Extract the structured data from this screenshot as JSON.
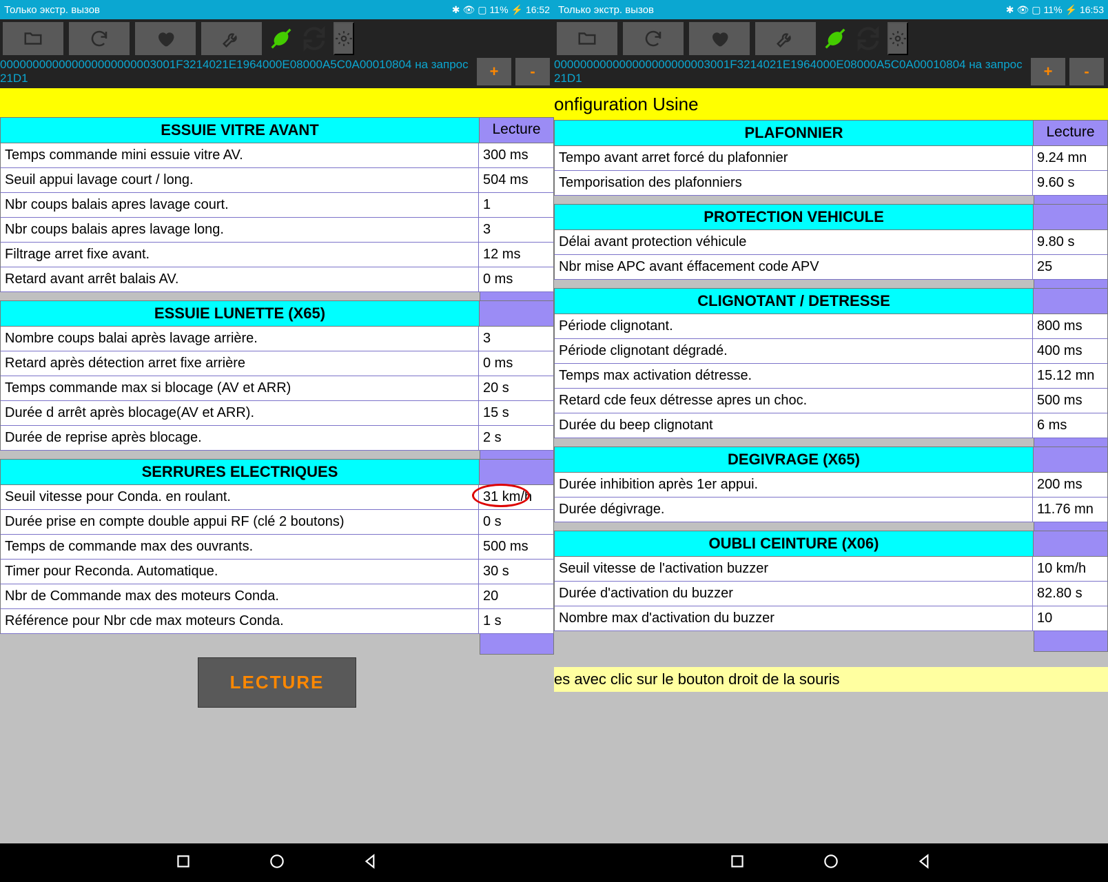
{
  "left": {
    "status": {
      "carrier": "Только экстр. вызов",
      "battery": "11%",
      "time": "16:52"
    },
    "info_line": "000000000000000000000003001F3214021E1964000E08000A5C0A00010804 на запрос 21D1",
    "plus": "+",
    "minus": "-",
    "lecture_btn": "LECTURE",
    "lecture_label": "Lecture",
    "sections": [
      {
        "title": "ESSUIE VITRE AVANT",
        "rows": [
          {
            "label": "Temps commande mini essuie vitre AV.",
            "value": "300 ms"
          },
          {
            "label": "Seuil appui lavage court / long.",
            "value": "504 ms"
          },
          {
            "label": "Nbr coups balais apres lavage court.",
            "value": "1"
          },
          {
            "label": "Nbr coups balais apres lavage long.",
            "value": "3"
          },
          {
            "label": "Filtrage arret fixe avant.",
            "value": "12 ms"
          },
          {
            "label": "Retard avant arrêt balais AV.",
            "value": "0 ms"
          }
        ]
      },
      {
        "title": "ESSUIE LUNETTE (X65)",
        "rows": [
          {
            "label": "Nombre coups balai après lavage arrière.",
            "value": "3"
          },
          {
            "label": "Retard après détection arret fixe arrière",
            "value": "0 ms"
          },
          {
            "label": "Temps commande max si blocage (AV et ARR)",
            "value": "20 s"
          },
          {
            "label": "Durée d arrêt après blocage(AV et ARR).",
            "value": "15 s"
          },
          {
            "label": "Durée de reprise après blocage.",
            "value": "2 s"
          }
        ]
      },
      {
        "title": "SERRURES ELECTRIQUES",
        "rows": [
          {
            "label": "Seuil vitesse pour Conda. en roulant.",
            "value": "31 km/h",
            "circled": true
          },
          {
            "label": "Durée prise en compte double appui RF (clé 2 boutons)",
            "value": "0 s"
          },
          {
            "label": "Temps de commande max des ouvrants.",
            "value": "500 ms"
          },
          {
            "label": "Timer pour Reconda. Automatique.",
            "value": "30 s"
          },
          {
            "label": "Nbr de Commande max des moteurs Conda.",
            "value": "20"
          },
          {
            "label": "Référence pour Nbr cde max moteurs Conda.",
            "value": "1 s"
          }
        ]
      }
    ]
  },
  "right": {
    "status": {
      "carrier": "Только экстр. вызов",
      "battery": "11%",
      "time": "16:53"
    },
    "info_line": "000000000000000000000003001F3214021E1964000E08000A5C0A00010804 на запрос 21D1",
    "plus": "+",
    "minus": "-",
    "title_bar": "onfiguration Usine",
    "footer_note": "es avec clic sur le bouton droit de la souris",
    "lecture_label": "Lecture",
    "sections": [
      {
        "title": "PLAFONNIER",
        "rows": [
          {
            "label": "Tempo avant arret forcé du plafonnier",
            "value": "9.24 mn"
          },
          {
            "label": "Temporisation des plafonniers",
            "value": "9.60 s"
          }
        ]
      },
      {
        "title": "PROTECTION VEHICULE",
        "rows": [
          {
            "label": "Délai avant protection véhicule",
            "value": "9.80 s"
          },
          {
            "label": "Nbr mise APC avant éffacement code APV",
            "value": "25"
          }
        ]
      },
      {
        "title": "CLIGNOTANT /  DETRESSE",
        "rows": [
          {
            "label": "Période clignotant.",
            "value": "800 ms"
          },
          {
            "label": "Période clignotant dégradé.",
            "value": "400 ms"
          },
          {
            "label": "Temps max activation détresse.",
            "value": "15.12 mn"
          },
          {
            "label": "Retard cde feux détresse apres un choc.",
            "value": "500 ms"
          },
          {
            "label": "Durée du beep clignotant",
            "value": "6 ms"
          }
        ]
      },
      {
        "title": "DEGIVRAGE (X65)",
        "rows": [
          {
            "label": "Durée inhibition après 1er appui.",
            "value": "200 ms"
          },
          {
            "label": "Durée dégivrage.",
            "value": "11.76 mn"
          }
        ]
      },
      {
        "title": "OUBLI CEINTURE (X06)",
        "rows": [
          {
            "label": "Seuil vitesse de l'activation buzzer",
            "value": "10 km/h"
          },
          {
            "label": "Durée d'activation du buzzer",
            "value": "82.80 s"
          },
          {
            "label": "Nombre max d'activation du buzzer",
            "value": "10"
          }
        ]
      }
    ]
  }
}
